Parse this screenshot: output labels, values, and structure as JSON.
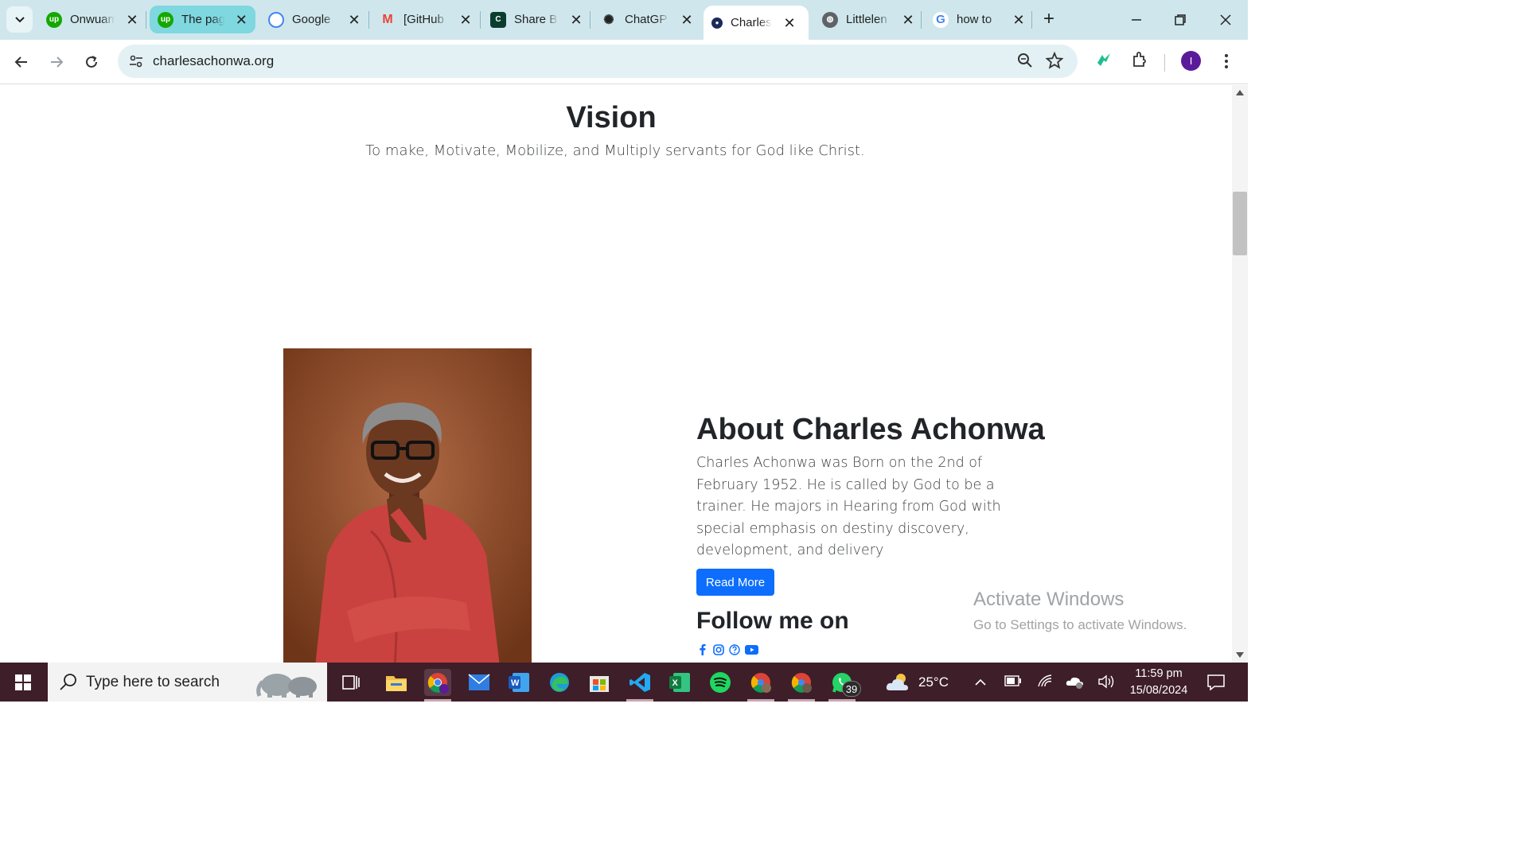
{
  "browser": {
    "tabs": [
      {
        "title": "Onwuam",
        "favicon": "upwork-icon",
        "color": "#14a800",
        "state": "normal"
      },
      {
        "title": "The pag",
        "favicon": "upwork-icon",
        "color": "#14a800",
        "state": "highlight"
      },
      {
        "title": "Google",
        "favicon": "google-password-icon",
        "color": "#4285f4",
        "state": "normal"
      },
      {
        "title": "[GitHub",
        "favicon": "gmail-icon",
        "color": "#ea4335",
        "state": "normal"
      },
      {
        "title": "Share B",
        "favicon": "share-icon",
        "color": "#0b3d2e",
        "state": "normal"
      },
      {
        "title": "ChatGP",
        "favicon": "chatgpt-icon",
        "color": "#222222",
        "state": "normal"
      },
      {
        "title": "Charles",
        "favicon": "site-icon",
        "color": "#1a2a5a",
        "state": "active"
      },
      {
        "title": "Littlelen",
        "favicon": "globe-icon",
        "color": "#5f6368",
        "state": "normal"
      },
      {
        "title": "how to",
        "favicon": "google-icon",
        "color": "#4285f4",
        "state": "normal"
      }
    ],
    "url": "charlesachonwa.org",
    "avatar_initial": "I"
  },
  "page": {
    "vision_title": "Vision",
    "vision_text": "To make, Motivate, Mobilize, and Multiply servants for God like Christ.",
    "about_title": "About Charles Achonwa",
    "about_text": "Charles Achonwa was Born on the 2nd of February 1952. He is called by God to be a trainer. He majors in Hearing from God with special emphasis on destiny discovery, development, and delivery",
    "read_more_label": "Read More",
    "follow_title": "Follow me on",
    "social_icons": [
      "facebook-icon",
      "instagram-icon",
      "help-icon",
      "youtube-icon"
    ],
    "accent_color": "#0d6efd"
  },
  "watermark": {
    "line1": "Activate Windows",
    "line2": "Go to Settings to activate Windows."
  },
  "taskbar": {
    "search_placeholder": "Type here to search",
    "weather": "25°C",
    "time": "11:59 pm",
    "date": "15/08/2024",
    "whatsapp_badge": "39",
    "apps": [
      "task-view-icon",
      "file-explorer-icon",
      "chrome-icon",
      "mail-icon",
      "word-icon",
      "edge-icon",
      "store-icon",
      "vscode-icon",
      "excel-icon",
      "spotify-icon",
      "chrome-profile-icon",
      "chrome-profile2-icon",
      "whatsapp-icon"
    ]
  }
}
